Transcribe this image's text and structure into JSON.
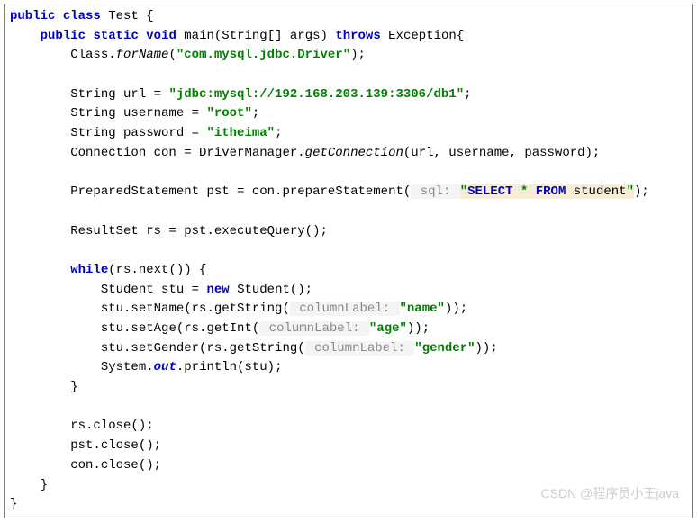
{
  "code": {
    "line1": {
      "kw1": "public",
      "kw2": "class",
      "name": "Test",
      "brace": " {"
    },
    "line2": {
      "kw1": "public",
      "kw2": "static",
      "kw3": "void",
      "method": "main(String[] args)",
      "kw4": "throws",
      "tail": "Exception{"
    },
    "line3": {
      "cls": "Class.",
      "method": "forName",
      "open": "(",
      "str": "\"com.mysql.jdbc.Driver\"",
      "close": ");"
    },
    "line4": {
      "text": "String url = ",
      "str": "\"jdbc:mysql://192.168.203.139:3306/db1\"",
      "semi": ";"
    },
    "line5": {
      "text": "String username = ",
      "str": "\"root\"",
      "semi": ";"
    },
    "line6": {
      "text": "String password = ",
      "str": "\"itheima\"",
      "semi": ";"
    },
    "line7": {
      "text": "Connection con = DriverManager.",
      "method": "getConnection",
      "tail": "(url, username, password);"
    },
    "line8": {
      "text": "PreparedStatement pst = con.prepareStatement(",
      "hint": " sql: ",
      "quote1": "\"",
      "kw1": "SELECT ",
      "star": "* ",
      "kw2": "FROM ",
      "table": "student",
      "quote2": "\"",
      "close": ");"
    },
    "line9": {
      "text": "ResultSet rs = pst.executeQuery();"
    },
    "line10": {
      "kw": "while",
      "tail": "(rs.next()) {"
    },
    "line11": {
      "text": "Student stu = ",
      "kw": "new",
      "tail": " Student();"
    },
    "line12": {
      "text": "stu.setName(rs.getString(",
      "hint": " columnLabel: ",
      "str": "\"name\"",
      "close": "));"
    },
    "line13": {
      "text": "stu.setAge(rs.getInt(",
      "hint": " columnLabel: ",
      "str": "\"age\"",
      "close": "));"
    },
    "line14": {
      "text": "stu.setGender(rs.getString(",
      "hint": " columnLabel: ",
      "str": "\"gender\"",
      "close": "));"
    },
    "line15": {
      "text": "System.",
      "out": "out",
      "tail": ".println(stu);"
    },
    "line16": {
      "brace": "}"
    },
    "line17": {
      "text": "rs.close();"
    },
    "line18": {
      "text": "pst.close();"
    },
    "line19": {
      "text": "con.close();"
    },
    "line20": {
      "brace": "}"
    },
    "line21": {
      "brace": "}"
    }
  },
  "watermark": "CSDN @程序员小王java"
}
